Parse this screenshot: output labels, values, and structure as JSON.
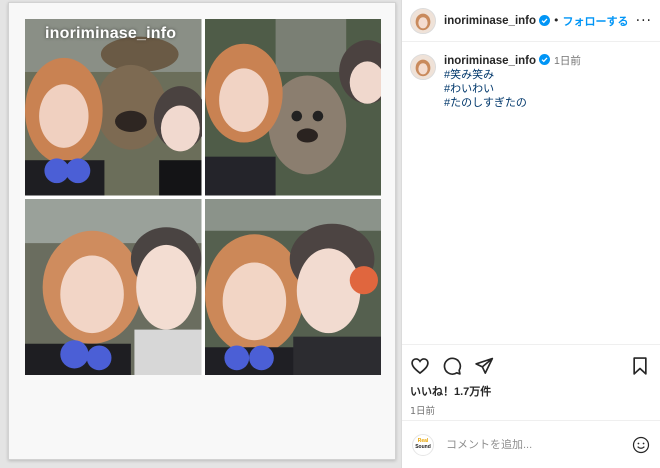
{
  "post": {
    "username": "inoriminase_info",
    "follow_label": "フォローする",
    "separator": "•",
    "more_label": "···",
    "watermark": "inoriminase_info"
  },
  "caption": {
    "username": "inoriminase_info",
    "time": "1日前",
    "hashtags": [
      "#笑み笑み",
      "#わいわい",
      "#たのしすぎたの"
    ]
  },
  "actions": {
    "icons": [
      "heart-icon",
      "comment-icon",
      "share-icon",
      "bookmark-icon"
    ],
    "likes": "いいね！1.7万件",
    "posted": "1日前"
  },
  "comment": {
    "placeholder": "コメントを追加...",
    "logo_line1": "Real",
    "logo_line2": "Sound"
  },
  "colors": {
    "accent": "#0095f6",
    "hashtag": "#00376b",
    "muted": "#737373"
  }
}
